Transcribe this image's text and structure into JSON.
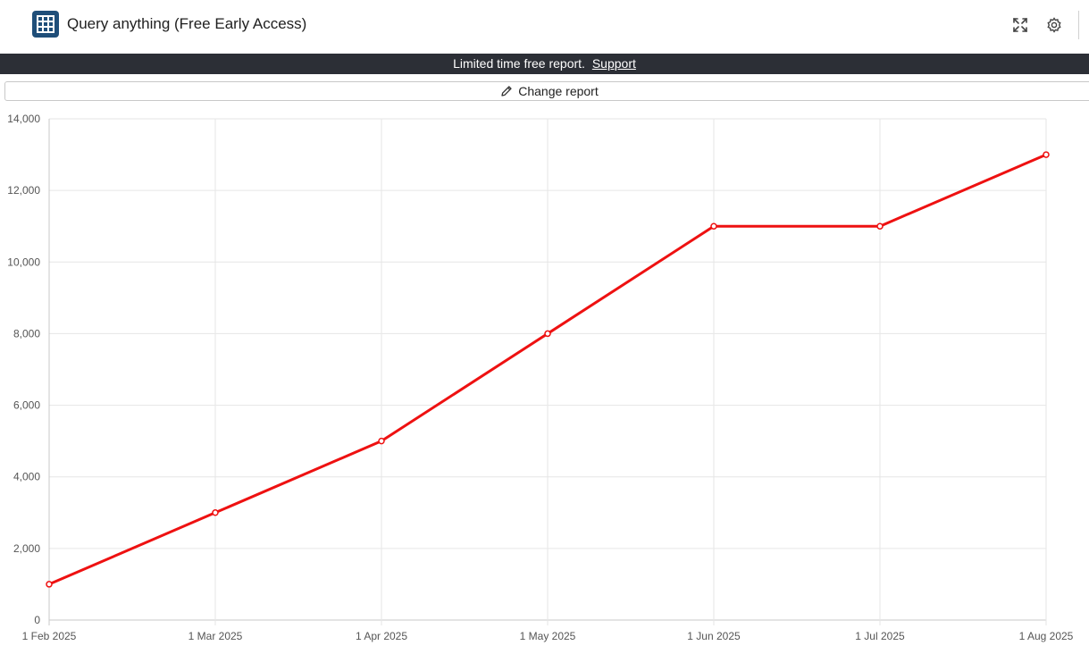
{
  "header": {
    "title": "Query anything (Free Early Access)",
    "app_icon": "table-grid-icon",
    "expand_icon": "expand-icon",
    "settings_icon": "gear-icon"
  },
  "banner": {
    "text": "Limited time free report.",
    "link_label": "Support",
    "background": "#2c2f36"
  },
  "toolbar": {
    "change_report_label": "Change report",
    "change_report_icon": "pencil-icon"
  },
  "chart_data": {
    "type": "line",
    "x": [
      "1 Feb 2025",
      "1 Mar 2025",
      "1 Apr 2025",
      "1 May 2025",
      "1 Jun 2025",
      "1 Jul 2025",
      "1 Aug 2025"
    ],
    "series": [
      {
        "values": [
          1000,
          3000,
          5000,
          8000,
          11000,
          11000,
          13000
        ],
        "color": "#ee1111"
      }
    ],
    "y_ticks": [
      "0",
      "2,000",
      "4,000",
      "6,000",
      "8,000",
      "10,000",
      "12,000",
      "14,000"
    ],
    "ylim": [
      0,
      14000
    ],
    "grid": true,
    "legend": "none"
  }
}
